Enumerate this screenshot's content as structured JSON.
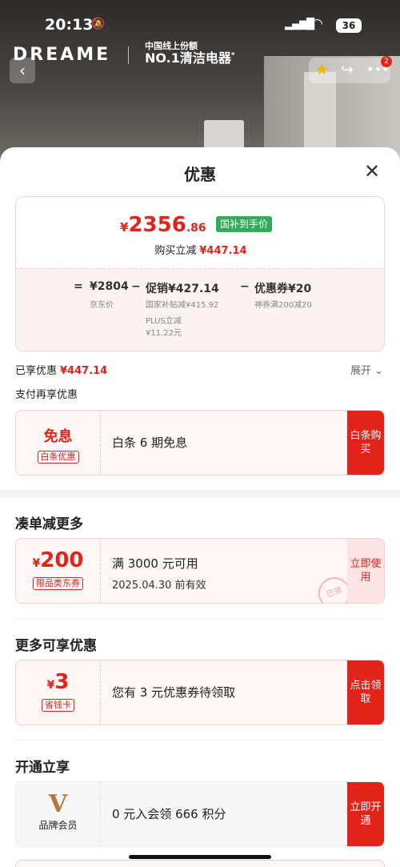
{
  "status": {
    "time": "20:13",
    "battery": "36"
  },
  "brand": {
    "name": "DREAME",
    "sub1": "中国线上份额",
    "sub2": "NO.1清洁电器",
    "sup": "*"
  },
  "nav": {
    "badge": "2"
  },
  "sheet": {
    "title": "优惠",
    "price": {
      "currency": "¥",
      "integer": "2356",
      "decimal": ".86",
      "tag": "国补到手价"
    },
    "instant_label": "购买立减",
    "instant_value": "¥447.14",
    "breakdown": {
      "eq": "=",
      "jd_price": "¥2804",
      "jd_label": "京东价",
      "minus1": "−",
      "promo": "促销¥427.14",
      "promo_sub1": "国家补贴减¥415.92",
      "promo_sub2": "PLUS立减",
      "promo_sub3": "¥11.22元",
      "minus2": "−",
      "coupon": "优惠券¥20",
      "coupon_sub": "神券满200减20"
    },
    "enjoyed_label": "已享优惠",
    "enjoyed_value": "¥447.14",
    "expand_label": "展开",
    "pay_label": "支付再享优惠",
    "baitiao": {
      "title": "免息",
      "tag": "白条优惠",
      "desc": "白条 6 期免息",
      "action": "白条购买"
    },
    "more_deals": {
      "title": "凑单减更多",
      "currency": "¥",
      "amount": "200",
      "tag": "限品类东券",
      "desc": "满 3000 元可用",
      "valid": "2025.04.30 前有效",
      "action": "立即使用",
      "stamp": "已领"
    },
    "more_offers": {
      "title": "更多可享优惠",
      "currency": "¥",
      "amount": "3",
      "tag": "省钱卡",
      "desc": "您有 3 元优惠券待领取",
      "action": "点击领取"
    },
    "membership": {
      "title": "开通立享",
      "logo": "V",
      "label": "品牌会员",
      "desc": "0 元入会领 666 积分",
      "action": "立即开通"
    }
  }
}
